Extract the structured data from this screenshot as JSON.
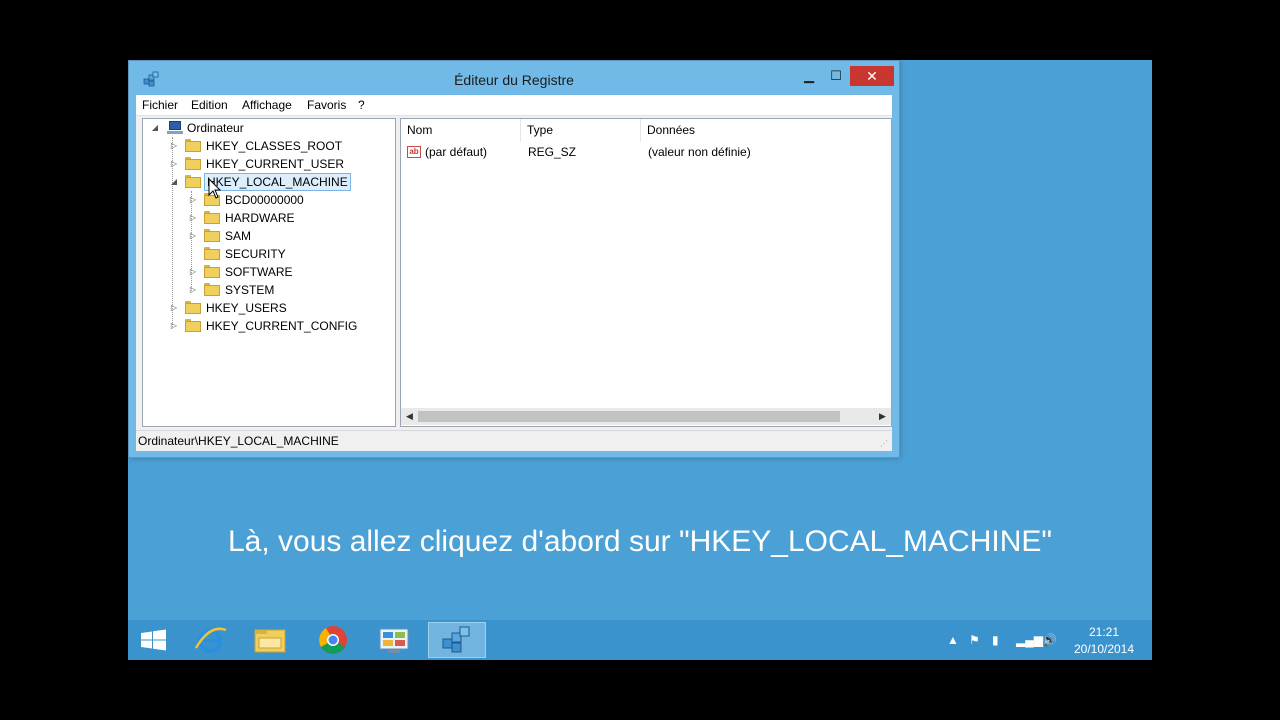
{
  "window": {
    "title": "Éditeur du Registre",
    "minimize": "▁",
    "maximize": "☐",
    "close": "✕"
  },
  "menu": [
    "Fichier",
    "Edition",
    "Affichage",
    "Favoris",
    "?"
  ],
  "tree": {
    "root": "Ordinateur",
    "hives": [
      "HKEY_CLASSES_ROOT",
      "HKEY_CURRENT_USER",
      "HKEY_LOCAL_MACHINE",
      "HKEY_USERS",
      "HKEY_CURRENT_CONFIG"
    ],
    "selected": "HKEY_LOCAL_MACHINE",
    "hklm_children": [
      "BCD00000000",
      "HARDWARE",
      "SAM",
      "SECURITY",
      "SOFTWARE",
      "SYSTEM"
    ]
  },
  "list": {
    "columns": [
      "Nom",
      "Type",
      "Données"
    ],
    "rows": [
      {
        "icon": "ab",
        "name": "(par défaut)",
        "type": "REG_SZ",
        "data": "(valeur non définie)"
      }
    ]
  },
  "status": {
    "path": "Ordinateur\\HKEY_LOCAL_MACHINE"
  },
  "subtitle": "Là, vous allez cliquez d'abord sur \"HKEY_LOCAL_MACHINE\"",
  "taskbar": {
    "apps": [
      "windows-start-icon",
      "internet-explorer-icon",
      "file-explorer-icon",
      "chrome-icon",
      "control-panel-icon",
      "regedit-icon"
    ],
    "clock_time": "21:21",
    "clock_date": "20/10/2014"
  },
  "colors": {
    "desktop": "#4ba1d6",
    "window_frame": "#71b9e6",
    "close_button": "#c7372f",
    "taskbar": "#3a93cd"
  }
}
